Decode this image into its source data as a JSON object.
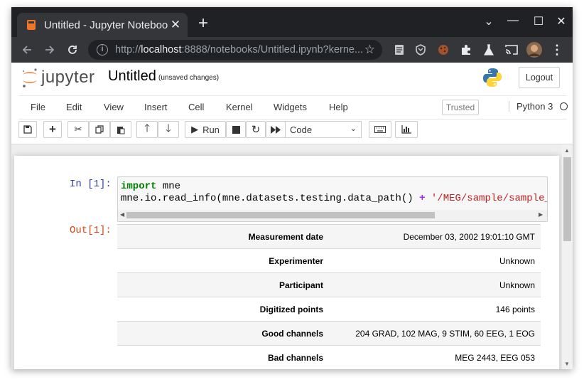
{
  "browser": {
    "tab_title": "Untitled - Jupyter Notebook",
    "tab_close": "✕",
    "new_tab": "+",
    "url_host": "localhost",
    "url_rest": ":8888/notebooks/Untitled.ipynb?kerne...",
    "url_scheme": "http://",
    "window_controls": {
      "minimize": "—",
      "maximize": "☐",
      "close": "✕",
      "menu": "⌄"
    }
  },
  "jupyter": {
    "logo_text": "jupyter",
    "notebook_title": "Untitled",
    "save_status": "(unsaved changes)",
    "logout_label": "Logout",
    "menu": [
      "File",
      "Edit",
      "View",
      "Insert",
      "Cell",
      "Kernel",
      "Widgets",
      "Help"
    ],
    "trusted_label": "Trusted",
    "kernel_name": "Python 3",
    "run_label": "Run",
    "cell_type": "Code"
  },
  "cell": {
    "in_prompt": "In [1]:",
    "out_prompt": "Out[1]:",
    "code_line1_kw": "import",
    "code_line1_rest": " mne",
    "code_line2_a": "mne.io.read_info(mne.datasets.testing.data_path() ",
    "code_line2_op": "+",
    "code_line2_str": " '/MEG/sample/sample_"
  },
  "output_table": [
    {
      "key": "Measurement date",
      "value": "December 03, 2002 19:01:10 GMT"
    },
    {
      "key": "Experimenter",
      "value": "Unknown"
    },
    {
      "key": "Participant",
      "value": "Unknown"
    },
    {
      "key": "Digitized points",
      "value": "146 points"
    },
    {
      "key": "Good channels",
      "value": "204 GRAD, 102 MAG, 9 STIM, 60 EEG, 1 EOG"
    },
    {
      "key": "Bad channels",
      "value": "MEG 2443, EEG 053"
    }
  ]
}
